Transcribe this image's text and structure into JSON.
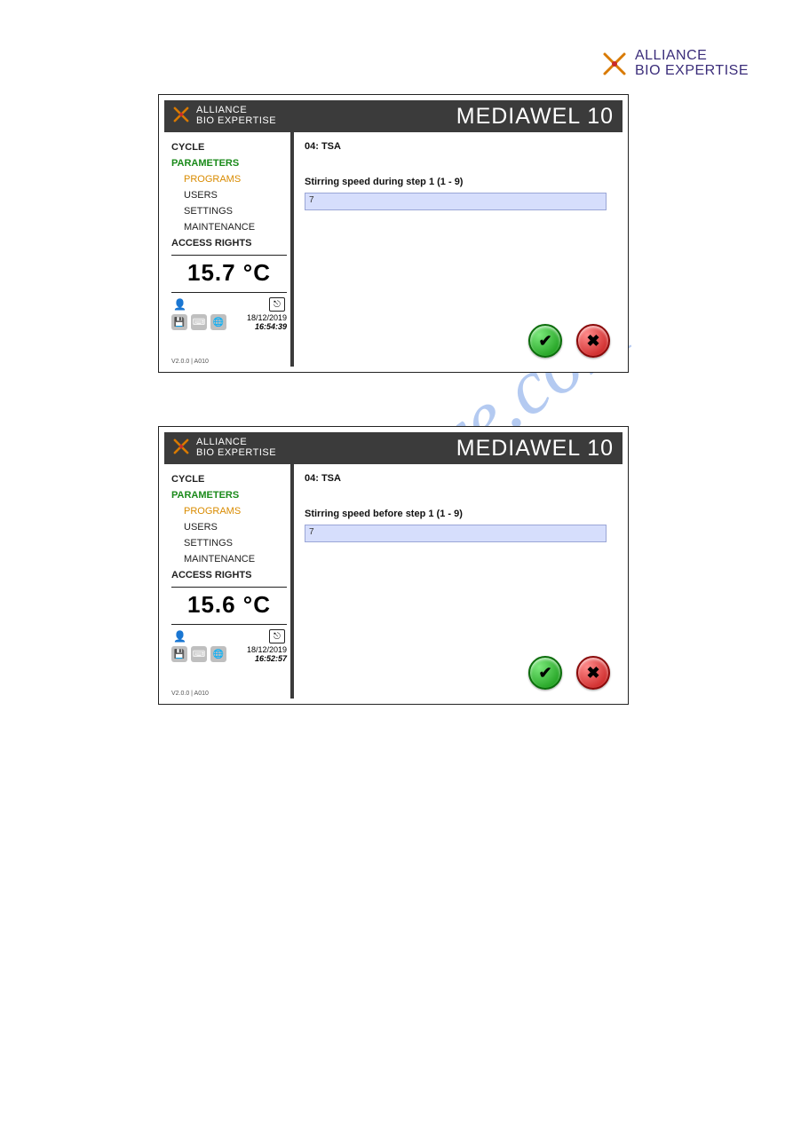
{
  "page_logo": {
    "line1": "ALLIANCE",
    "line2": "BIO EXPERTISE"
  },
  "watermark": "manualshive.com",
  "screens": [
    {
      "brand": {
        "line1": "ALLIANCE",
        "line2": "BIO EXPERTISE"
      },
      "title": "MEDIAWEL 10",
      "nav": {
        "cycle": "CYCLE",
        "parameters": "PARAMETERS",
        "programs": "PROGRAMS",
        "users": "USERS",
        "settings": "SETTINGS",
        "maintenance": "MAINTENANCE",
        "access": "ACCESS RIGHTS"
      },
      "temperature": "15.7 °C",
      "datetime": {
        "date": "18/12/2019",
        "time": "16:54:39"
      },
      "version": "V2.0.0 | A010",
      "program_title": "04: TSA",
      "field_label": "Stirring speed during step 1 (1 - 9)",
      "field_value": "7"
    },
    {
      "brand": {
        "line1": "ALLIANCE",
        "line2": "BIO EXPERTISE"
      },
      "title": "MEDIAWEL 10",
      "nav": {
        "cycle": "CYCLE",
        "parameters": "PARAMETERS",
        "programs": "PROGRAMS",
        "users": "USERS",
        "settings": "SETTINGS",
        "maintenance": "MAINTENANCE",
        "access": "ACCESS RIGHTS"
      },
      "temperature": "15.6 °C",
      "datetime": {
        "date": "18/12/2019",
        "time": "16:52:57"
      },
      "version": "V2.0.0 | A010",
      "program_title": "04: TSA",
      "field_label": "Stirring speed before step 1 (1 - 9)",
      "field_value": "7"
    }
  ]
}
